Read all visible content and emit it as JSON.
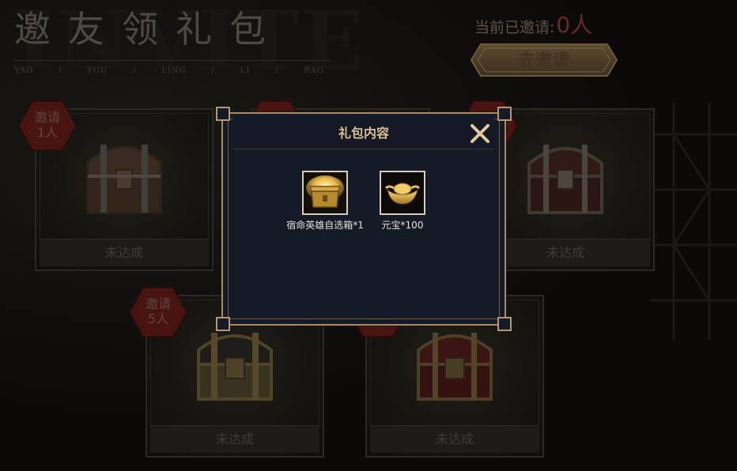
{
  "header": {
    "background_word": "INVITE",
    "title": "邀友领礼包",
    "pinyin": [
      "YAO",
      "/",
      "YOU",
      "/",
      "LING",
      "/",
      "LI",
      "/",
      "BAO"
    ],
    "invited_label": "当前已邀请:",
    "invited_count": "0人",
    "invite_button": "去邀请"
  },
  "cards": [
    {
      "badge_line1": "邀请",
      "badge_line2": "1人",
      "status": "未达成",
      "chest": "wooden-chest"
    },
    {
      "badge_line1": "",
      "badge_line2": "",
      "status": "",
      "chest": "hidden-chest"
    },
    {
      "badge_line1": "",
      "badge_line2": "",
      "status": "未达成",
      "chest": "dark-red-chest"
    },
    {
      "badge_line1": "邀请",
      "badge_line2": "5人",
      "status": "未达成",
      "chest": "gold-black-chest"
    },
    {
      "badge_line1": "",
      "badge_line2": "",
      "status": "未达成",
      "chest": "red-gold-chest"
    }
  ],
  "modal": {
    "title": "礼包内容",
    "close_icon": "close-icon",
    "items": [
      {
        "icon": "gold-treasure-box-icon",
        "label": "宿命英雄自选箱*1"
      },
      {
        "icon": "gold-ingot-icon",
        "label": "元宝*100"
      }
    ]
  },
  "colors": {
    "modal_bg": "#151a27",
    "modal_border": "#a98a63",
    "modal_title": "#d9bf97",
    "badge_fill": "#5a1512",
    "invite_count": "#6a2a26"
  }
}
